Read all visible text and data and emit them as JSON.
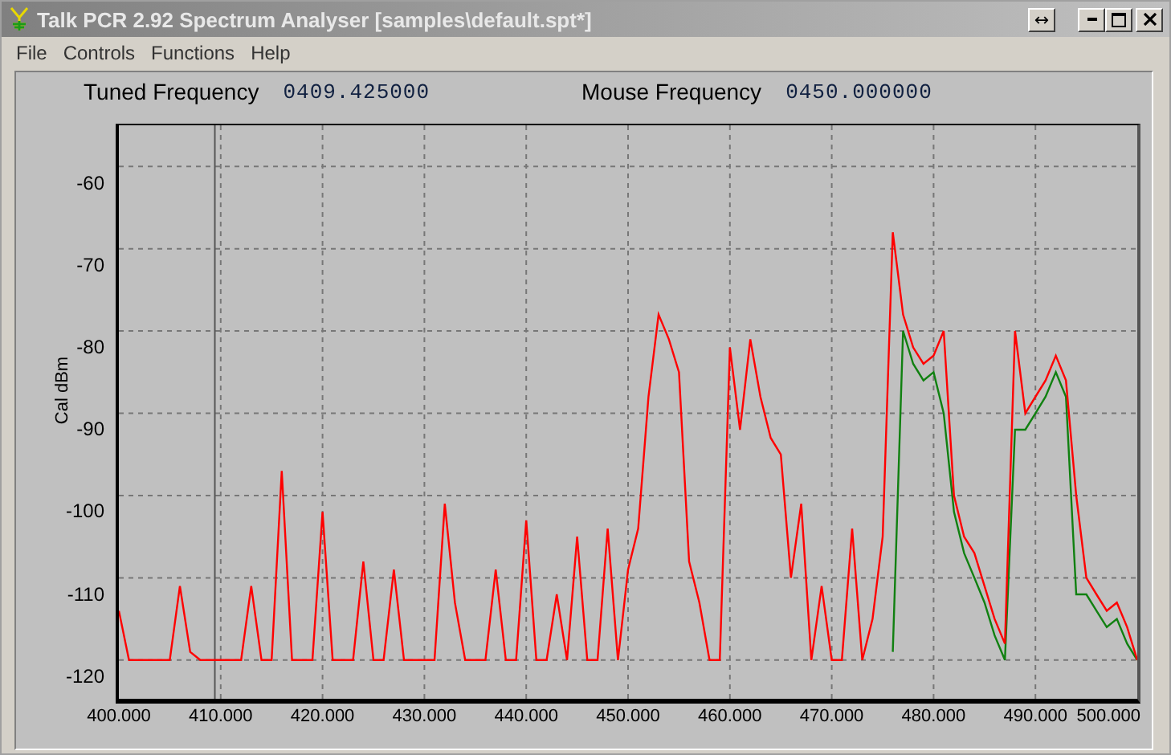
{
  "window": {
    "title": "Talk PCR 2.92 Spectrum Analyser [samples\\default.spt*]",
    "buttons": [
      {
        "kind": "dock",
        "label": "↔"
      },
      {
        "kind": "minimize"
      },
      {
        "kind": "maximize"
      },
      {
        "kind": "close"
      }
    ]
  },
  "menu": [
    "File",
    "Controls",
    "Functions",
    "Help"
  ],
  "readouts": [
    {
      "label": "Tuned Frequency",
      "value": "0409.425000"
    },
    {
      "label": "Mouse Frequency",
      "value": "0450.000000"
    }
  ],
  "chart_data": {
    "type": "line",
    "ylabel": "Cal dBm",
    "xlim": [
      400,
      500
    ],
    "ylim": [
      -124.7,
      -55
    ],
    "x": [
      400,
      401,
      402,
      403,
      404,
      405,
      406,
      407,
      408,
      409,
      410,
      411,
      412,
      413,
      414,
      415,
      416,
      417,
      418,
      419,
      420,
      421,
      422,
      423,
      424,
      425,
      426,
      427,
      428,
      429,
      430,
      431,
      432,
      433,
      434,
      435,
      436,
      437,
      438,
      439,
      440,
      441,
      442,
      443,
      444,
      445,
      446,
      447,
      448,
      449,
      450,
      451,
      452,
      453,
      454,
      455,
      456,
      457,
      458,
      459,
      460,
      461,
      462,
      463,
      464,
      465,
      466,
      467,
      468,
      469,
      470,
      471,
      472,
      473,
      474,
      475,
      476,
      477,
      478,
      479,
      480,
      481,
      482,
      483,
      484,
      485,
      486,
      487,
      488,
      489,
      490,
      491,
      492,
      493,
      494,
      495,
      496,
      497,
      498,
      499,
      500
    ],
    "series": [
      {
        "color": "#108010",
        "values": [
          null,
          null,
          null,
          null,
          null,
          null,
          null,
          null,
          null,
          null,
          null,
          null,
          null,
          null,
          null,
          null,
          null,
          null,
          null,
          null,
          null,
          null,
          null,
          null,
          null,
          null,
          null,
          null,
          null,
          null,
          null,
          null,
          null,
          null,
          null,
          null,
          null,
          null,
          null,
          null,
          null,
          null,
          null,
          null,
          null,
          null,
          null,
          null,
          null,
          null,
          null,
          null,
          null,
          null,
          null,
          null,
          null,
          null,
          null,
          null,
          null,
          null,
          null,
          null,
          null,
          null,
          null,
          null,
          null,
          null,
          null,
          null,
          null,
          null,
          null,
          null,
          -119,
          -80,
          -84,
          -86,
          -85,
          -90,
          -102,
          -107,
          -110,
          -113,
          -117,
          -120,
          -92,
          -92,
          -90,
          -88,
          -85,
          -88,
          -112,
          -112,
          -114,
          -116,
          -115,
          -118,
          -120
        ]
      },
      {
        "color": "#ff0000",
        "values": [
          -114,
          -120,
          -120,
          -120,
          -120,
          -120,
          -111,
          -119,
          -120,
          -120,
          -120,
          -120,
          -120,
          -111,
          -120,
          -120,
          -97,
          -120,
          -120,
          -120,
          -102,
          -120,
          -120,
          -120,
          -108,
          -120,
          -120,
          -109,
          -120,
          -120,
          -120,
          -120,
          -101,
          -113,
          -120,
          -120,
          -120,
          -109,
          -120,
          -120,
          -103,
          -120,
          -120,
          -112,
          -120,
          -105,
          -120,
          -120,
          -104,
          -120,
          -109,
          -104,
          -88,
          -78,
          -81,
          -85,
          -108,
          -113,
          -120,
          -120,
          -82,
          -92,
          -81,
          -88,
          -93,
          -95,
          -110,
          -101,
          -120,
          -111,
          -120,
          -120,
          -104,
          -120,
          -115,
          -105,
          -68,
          -78,
          -82,
          -84,
          -83,
          -80,
          -100,
          -105,
          -107,
          -111,
          -115,
          -118,
          -80,
          -90,
          -88,
          -86,
          -83,
          -86,
          -100,
          -110,
          -112,
          -114,
          -113,
          -116,
          -120
        ]
      }
    ],
    "yticks": [
      -60,
      -70,
      -80,
      -90,
      -100,
      -110,
      -120
    ],
    "grid": true,
    "ref_lines": [
      {
        "axis": "x",
        "value": 409.425,
        "color": "#555555"
      }
    ],
    "xticks": [
      {
        "value": 400,
        "label": "400.000"
      },
      {
        "value": 410,
        "label": "410.000"
      },
      {
        "value": 420,
        "label": "420.000"
      },
      {
        "value": 430,
        "label": "430.000"
      },
      {
        "value": 440,
        "label": "440.000"
      },
      {
        "value": 450,
        "label": "450.000"
      },
      {
        "value": 460,
        "label": "460.000"
      },
      {
        "value": 470,
        "label": "470.000"
      },
      {
        "value": 480,
        "label": "480.000"
      },
      {
        "value": 490,
        "label": "490.000"
      },
      {
        "value": 500,
        "label": "500.000"
      }
    ]
  }
}
